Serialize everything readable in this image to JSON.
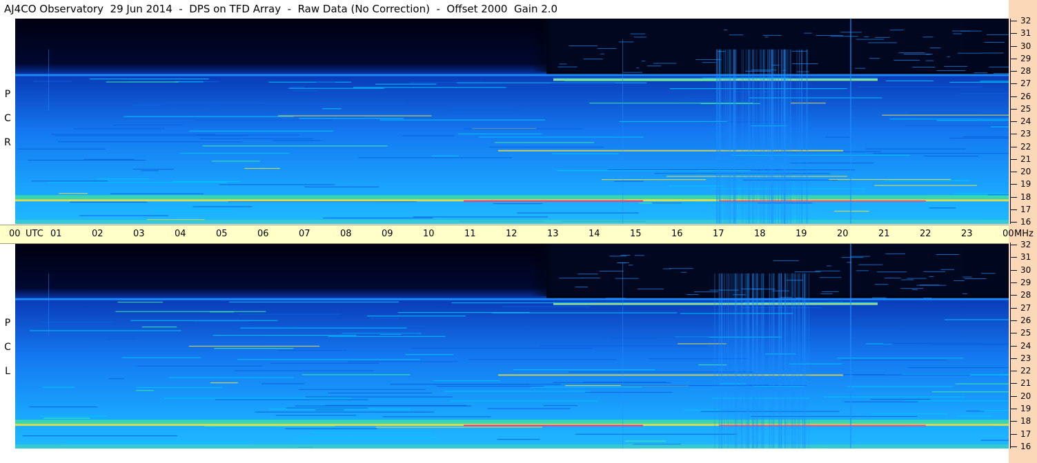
{
  "title": "AJ4CO Observatory  29 Jun 2014  -  DPS on TFD Array  -  Raw Data (No Correction)  -  Offset 2000  Gain 2.0",
  "polarizations": {
    "top": [
      "R",
      "C",
      "P"
    ],
    "bottom": [
      "L",
      "C",
      "P"
    ]
  },
  "time_axis": {
    "labels": [
      "00",
      "UTC",
      "01",
      "02",
      "03",
      "04",
      "05",
      "06",
      "07",
      "08",
      "09",
      "10",
      "11",
      "12",
      "13",
      "14",
      "15",
      "16",
      "17",
      "18",
      "19",
      "20",
      "21",
      "22",
      "23",
      "00",
      "MHz"
    ]
  },
  "freq_axis": {
    "labels": [
      "32",
      "31",
      "30",
      "29",
      "28",
      "27",
      "26",
      "25",
      "24",
      "23",
      "22",
      "21",
      "20",
      "19",
      "18",
      "17",
      "16"
    ],
    "range": [
      16,
      32
    ]
  },
  "colors": {
    "background_sky": "#0a3aa8",
    "quiet": "#1a8cff",
    "active": "#00c8ff",
    "strong": "#f0e040",
    "peak": "#ff3080",
    "axis_band": "#ffffc8",
    "side_strip": "#fbd9b8"
  }
}
